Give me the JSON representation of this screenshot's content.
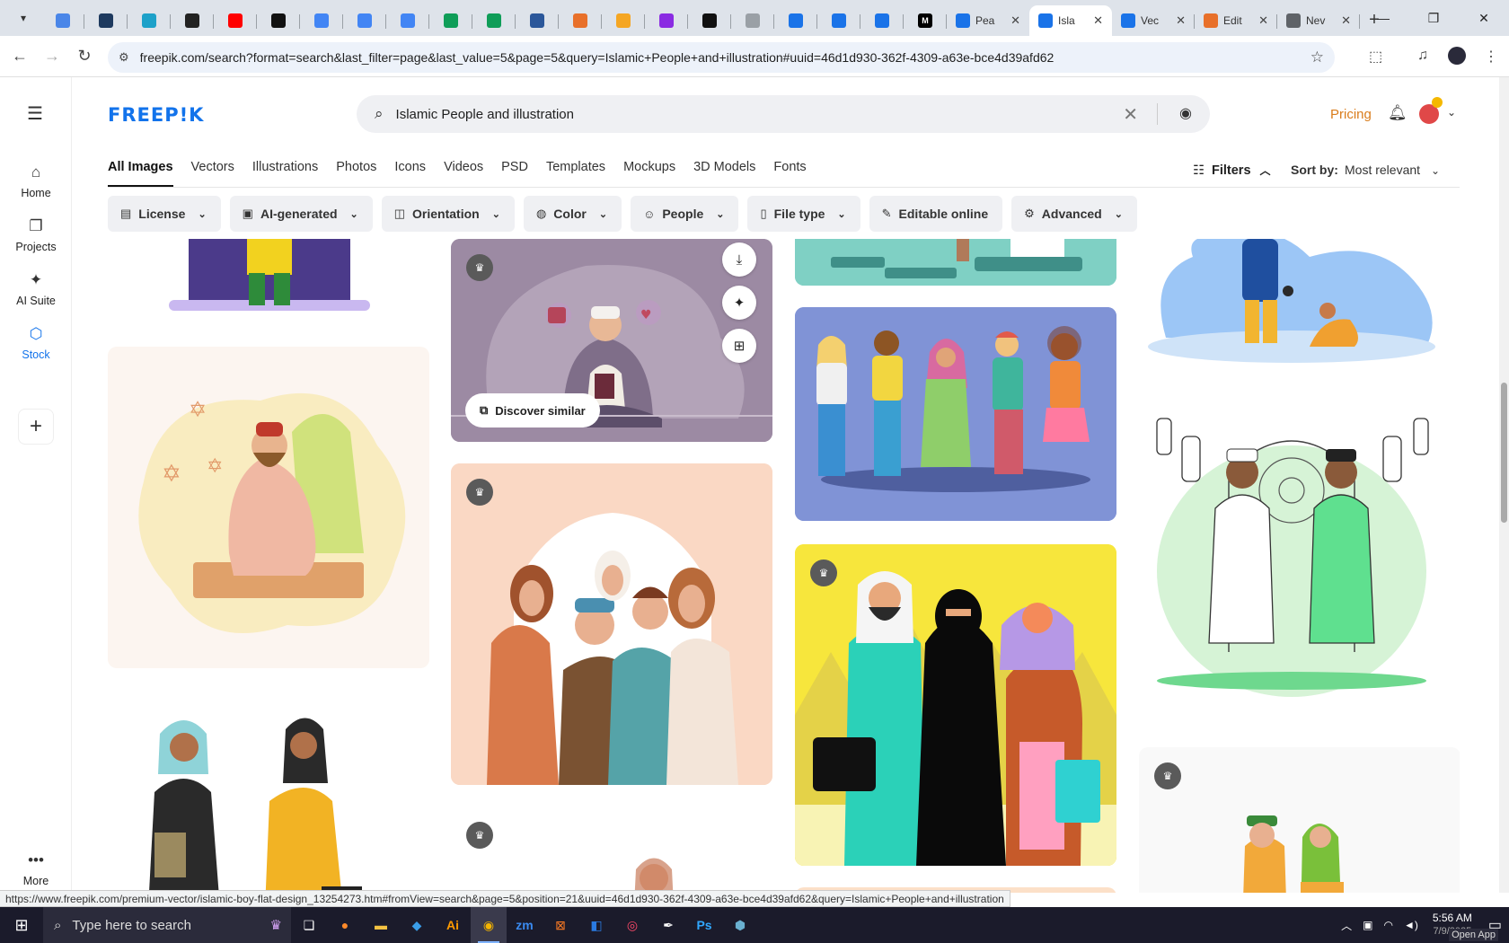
{
  "browser": {
    "tabs": [
      {
        "title": "",
        "color": "#4a86e8",
        "glyph": ""
      },
      {
        "title": "",
        "color": "#1e3a5f",
        "glyph": ""
      },
      {
        "title": "",
        "color": "#1da1c9",
        "glyph": ""
      },
      {
        "title": "",
        "color": "#222222",
        "glyph": ""
      },
      {
        "title": "",
        "color": "#ff0000",
        "glyph": ""
      },
      {
        "title": "",
        "color": "#111111",
        "glyph": ""
      },
      {
        "title": "",
        "color": "#4285f4",
        "glyph": ""
      },
      {
        "title": "",
        "color": "#4285f4",
        "glyph": ""
      },
      {
        "title": "",
        "color": "#4285f4",
        "glyph": ""
      },
      {
        "title": "",
        "color": "#0f9d58",
        "glyph": ""
      },
      {
        "title": "",
        "color": "#0f9d58",
        "glyph": ""
      },
      {
        "title": "",
        "color": "#2b579a",
        "glyph": ""
      },
      {
        "title": "",
        "color": "#e8702a",
        "glyph": ""
      },
      {
        "title": "",
        "color": "#f5a623",
        "glyph": ""
      },
      {
        "title": "",
        "color": "#8a2be2",
        "glyph": ""
      },
      {
        "title": "",
        "color": "#111111",
        "glyph": ""
      },
      {
        "title": "",
        "color": "#9aa0a6",
        "glyph": ""
      },
      {
        "title": "",
        "color": "#1a73e8",
        "glyph": ""
      },
      {
        "title": "",
        "color": "#1a73e8",
        "glyph": ""
      },
      {
        "title": "",
        "color": "#1a73e8",
        "glyph": ""
      },
      {
        "title": "",
        "color": "#000000",
        "glyph": "M"
      },
      {
        "title": "Pea",
        "color": "#1a73e8",
        "glyph": ""
      },
      {
        "title": "Isla",
        "color": "#1a73e8",
        "glyph": ""
      },
      {
        "title": "Vec",
        "color": "#1a73e8",
        "glyph": ""
      },
      {
        "title": "Edit",
        "color": "#e8702a",
        "glyph": ""
      },
      {
        "title": "Nev",
        "color": "#5f6368",
        "glyph": ""
      }
    ],
    "active_tab": 22,
    "url": "freepik.com/search?format=search&last_filter=page&last_value=5&page=5&query=Islamic+People+and+illustration#uuid=46d1d930-362f-4309-a63e-bce4d39afd62",
    "status_url": "https://www.freepik.com/premium-vector/islamic-boy-flat-design_13254273.htm#fromView=search&page=5&position=21&uuid=46d1d930-362f-4309-a63e-bce4d39afd62&query=Islamic+People+and+illustration"
  },
  "sidebar": {
    "items": [
      {
        "label": "Home",
        "icon": "home-icon",
        "glyph": "⌂"
      },
      {
        "label": "Projects",
        "icon": "projects-icon",
        "glyph": "❐"
      },
      {
        "label": "AI Suite",
        "icon": "ai-suite-icon",
        "glyph": "✦"
      },
      {
        "label": "Stock",
        "icon": "stock-icon",
        "glyph": "⬡"
      }
    ],
    "active_index": 3,
    "more_label": "More"
  },
  "header": {
    "logo": "FREEP!K",
    "search_value": "Islamic People and illustration",
    "pricing": "Pricing"
  },
  "categories": [
    "All Images",
    "Vectors",
    "Illustrations",
    "Photos",
    "Icons",
    "Videos",
    "PSD",
    "Templates",
    "Mockups",
    "3D Models",
    "Fonts"
  ],
  "active_category": 0,
  "filters_label": "Filters",
  "sort": {
    "label": "Sort by:",
    "value": "Most relevant"
  },
  "chips": [
    {
      "label": "License",
      "icon": "license-icon",
      "glyph": "▤"
    },
    {
      "label": "AI-generated",
      "icon": "ai-generated-icon",
      "glyph": "▣"
    },
    {
      "label": "Orientation",
      "icon": "orientation-icon",
      "glyph": "◫"
    },
    {
      "label": "Color",
      "icon": "palette-icon",
      "glyph": "◍"
    },
    {
      "label": "People",
      "icon": "people-icon",
      "glyph": "☺"
    },
    {
      "label": "File type",
      "icon": "file-icon",
      "glyph": "▯"
    },
    {
      "label": "Editable online",
      "icon": "pencil-icon",
      "glyph": "✎"
    },
    {
      "label": "Advanced",
      "icon": "gear-icon",
      "glyph": "⚙"
    }
  ],
  "discover_similar": "Discover similar",
  "taskbar": {
    "search_placeholder": "Type here to search",
    "time": "5:56 AM",
    "date": "7/9/2025",
    "open_app": "Open App"
  }
}
